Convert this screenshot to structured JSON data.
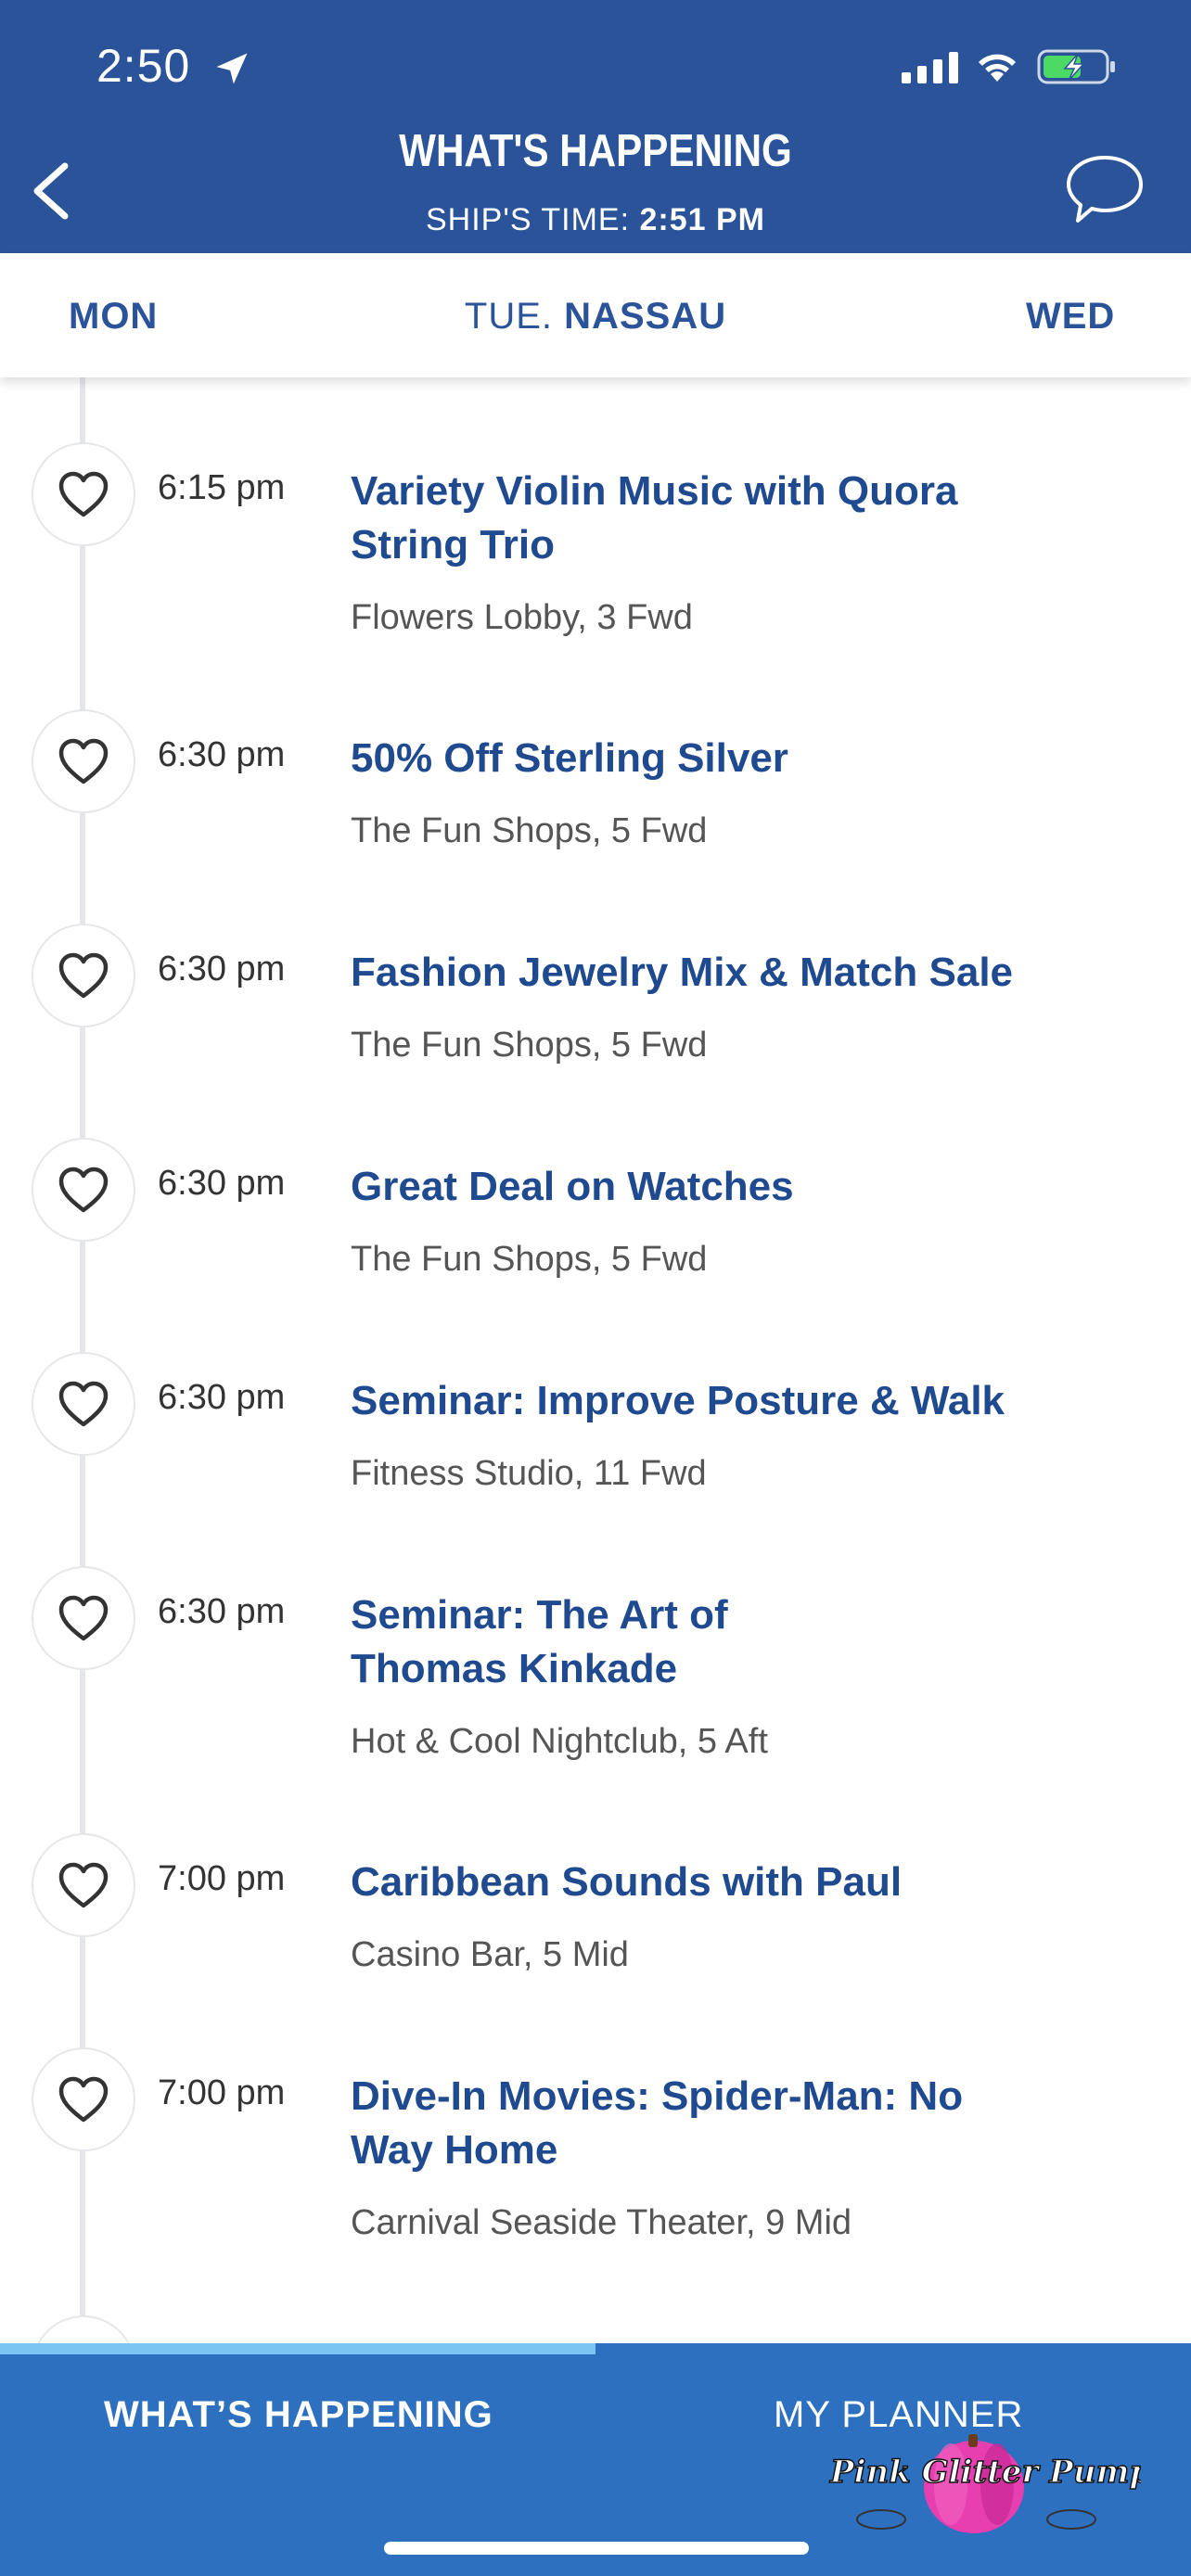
{
  "status_bar": {
    "time": "2:50"
  },
  "header": {
    "title": "WHAT'S HAPPENING",
    "ship_time_label": "SHIP'S TIME:",
    "ship_time_value": "2:51 PM"
  },
  "day_nav": {
    "prev": "MON",
    "current_day": "TUE.",
    "current_port": "NASSAU",
    "next": "WED"
  },
  "events": [
    {
      "time": "6:15 pm",
      "title_lines": [
        "Variety Violin Music with Quora",
        "String Trio"
      ],
      "location": "Flowers Lobby, 3 Fwd"
    },
    {
      "time": "6:30 pm",
      "title_lines": [
        "50% Off Sterling Silver"
      ],
      "location": "The Fun Shops, 5 Fwd"
    },
    {
      "time": "6:30 pm",
      "title_lines": [
        "Fashion Jewelry Mix & Match Sale"
      ],
      "location": "The Fun Shops, 5 Fwd"
    },
    {
      "time": "6:30 pm",
      "title_lines": [
        "Great Deal on Watches"
      ],
      "location": "The Fun Shops, 5 Fwd"
    },
    {
      "time": "6:30 pm",
      "title_lines": [
        "Seminar: Improve Posture & Walk"
      ],
      "location": "Fitness Studio, 11 Fwd"
    },
    {
      "time": "6:30 pm",
      "title_lines": [
        "Seminar: The Art of",
        "Thomas Kinkade"
      ],
      "location": "Hot & Cool Nightclub, 5 Aft"
    },
    {
      "time": "7:00 pm",
      "title_lines": [
        "Caribbean Sounds with Paul"
      ],
      "location": "Casino Bar, 5 Mid"
    },
    {
      "time": "7:00 pm",
      "title_lines": [
        "Dive-In Movies: Spider-Man: No",
        "Way Home"
      ],
      "location": "Carnival Seaside Theater, 9 Mid"
    }
  ],
  "tabs": {
    "whats_happening": "WHAT’S HAPPENING",
    "my_planner": "MY PLANNER"
  },
  "watermark": {
    "text": "Pink Glitter Pumpkins"
  },
  "icons": {
    "heart": "heart-outline-icon",
    "back": "chevron-left-icon",
    "chat": "chat-bubble-icon",
    "location": "location-arrow-icon"
  },
  "colors": {
    "header_bg": "#2a5399",
    "title_blue": "#1f4a8f",
    "tab_bg": "#2e70c0",
    "tab_indicator": "#7cc4f2",
    "battery_green": "#4cd964"
  }
}
